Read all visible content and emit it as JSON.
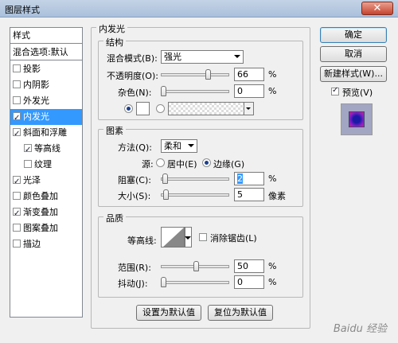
{
  "window": {
    "title": "图层样式",
    "close_label": "✕"
  },
  "styles": {
    "header": "样式",
    "blend_default": "混合选项:默认",
    "items": [
      {
        "label": "投影",
        "checked": false
      },
      {
        "label": "内阴影",
        "checked": false
      },
      {
        "label": "外发光",
        "checked": false
      },
      {
        "label": "内发光",
        "checked": true
      },
      {
        "label": "斜面和浮雕",
        "checked": true
      },
      {
        "label": "等高线",
        "checked": true
      },
      {
        "label": "纹理",
        "checked": false
      },
      {
        "label": "光泽",
        "checked": true
      },
      {
        "label": "颜色叠加",
        "checked": false
      },
      {
        "label": "渐变叠加",
        "checked": true
      },
      {
        "label": "图案叠加",
        "checked": false
      },
      {
        "label": "描边",
        "checked": false
      }
    ]
  },
  "panel": {
    "title": "内发光",
    "structure": {
      "title": "结构",
      "blend_label": "混合模式(B):",
      "blend_value": "强光",
      "opacity_label": "不透明度(O):",
      "opacity_value": "66",
      "opacity_unit": "%",
      "opacity": 0.66,
      "noise_label": "杂色(N):",
      "noise_value": "0",
      "noise_unit": "%",
      "noise": 0.0
    },
    "elements": {
      "title": "图素",
      "method_label": "方法(Q):",
      "method_value": "柔和",
      "source_label": "源:",
      "center_label": "居中(E)",
      "edge_label": "边缘(G)",
      "choke_label": "阻塞(C):",
      "choke_value": "2",
      "choke_unit": "%",
      "choke": 0.02,
      "size_label": "大小(S):",
      "size_value": "5",
      "size_unit": "像素",
      "size": 5
    },
    "quality": {
      "title": "品质",
      "contour_label": "等高线:",
      "antialias_label": "消除锯齿(L)",
      "range_label": "范围(R):",
      "range_value": "50",
      "range_unit": "%",
      "range": 0.5,
      "jitter_label": "抖动(J):",
      "jitter_value": "0",
      "jitter_unit": "%",
      "jitter": 0.0
    },
    "make_default": "设置为默认值",
    "reset_default": "复位为默认值"
  },
  "buttons": {
    "ok": "确定",
    "cancel": "取消",
    "new_style": "新建样式(W)...",
    "preview": "预览(V)"
  },
  "watermark": "Baidu 经验"
}
